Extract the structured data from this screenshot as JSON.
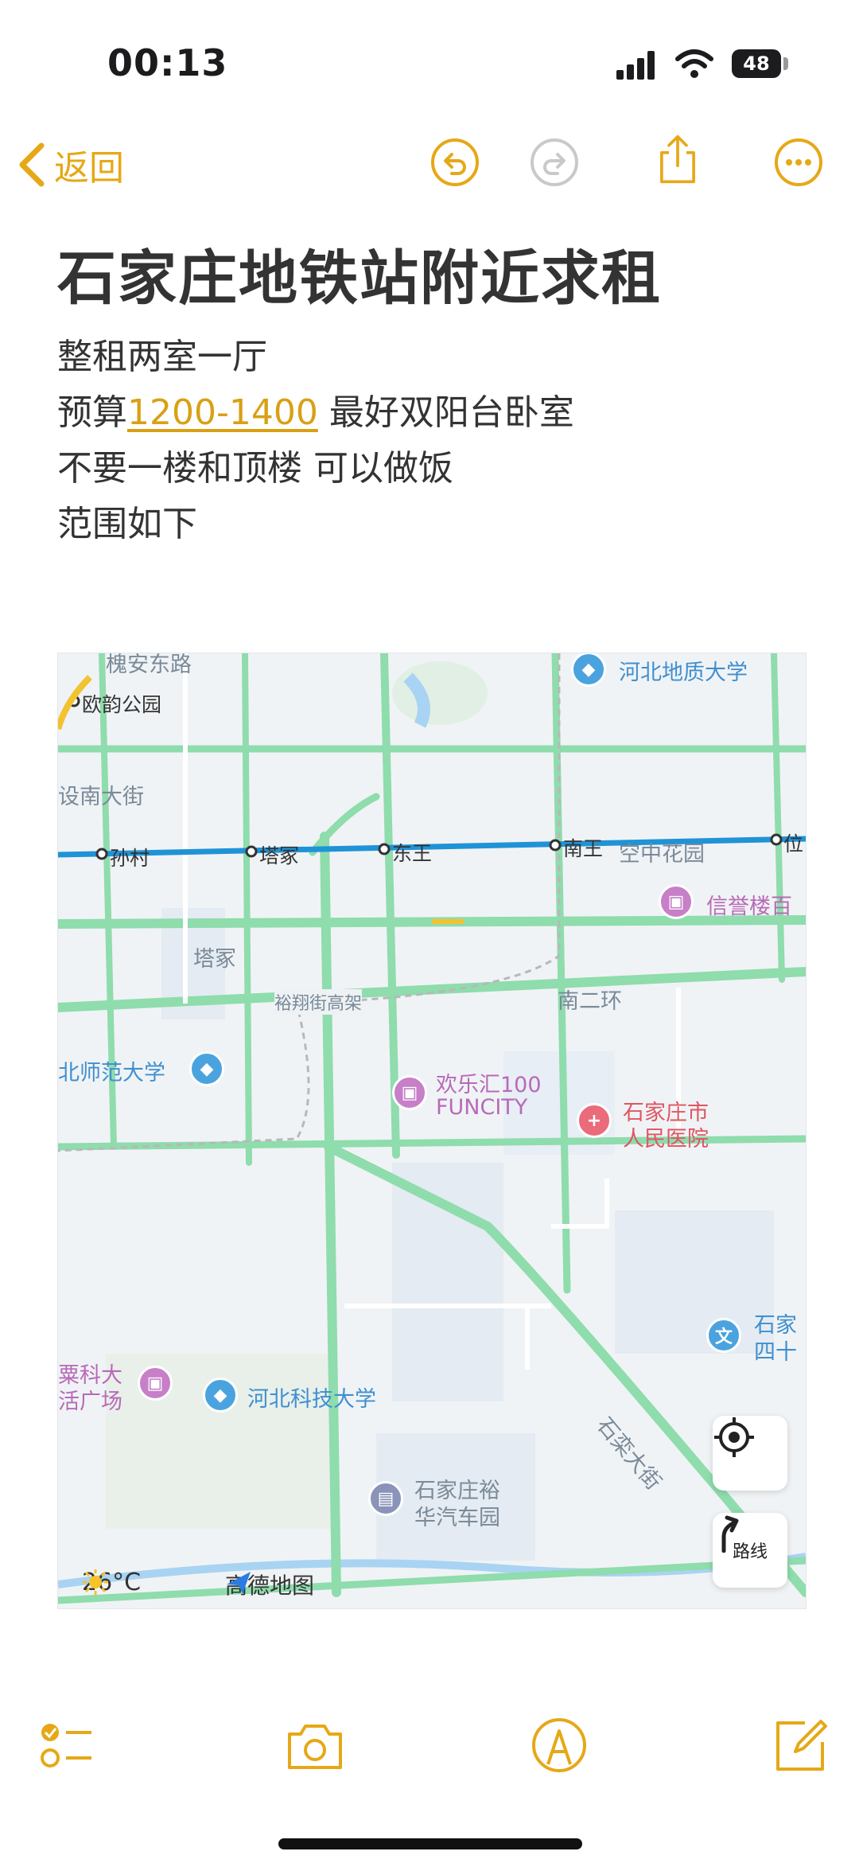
{
  "status_bar": {
    "time": "00:13",
    "battery": "48"
  },
  "nav": {
    "back_label": "返回"
  },
  "note": {
    "title": "石家庄地铁站附近求租",
    "line1": "整租两室一厅",
    "line2_prefix": "预算",
    "line2_link": "1200-1400",
    "line2_suffix": "最好双阳台卧室",
    "line3": "不要一楼和顶楼 可以做饭",
    "line4": "范围如下"
  },
  "map": {
    "labels": {
      "huaian_road": "槐安东路",
      "ouyun_park": "欧韵公园",
      "hebei_geo_univ": "河北地质大学",
      "jianshe_south": "设南大街",
      "suncun": "孙村",
      "tazhong_station": "塔冢",
      "dongwang": "东王",
      "nanwang": "南王",
      "wei": "位",
      "sky_garden": "空中花园",
      "xinyu_mall": "信誉楼百",
      "tazhong_area": "塔冢",
      "yuxiang_elevated": "裕翔街高架",
      "south_2nd_ring": "南二环",
      "hebei_normal": "北师范大学",
      "huanlehui": "欢乐汇100",
      "funcity": "FUNCITY",
      "sjz_hospital_1": "石家庄市",
      "sjz_hospital_2": "人民医院",
      "sjz_school_1": "石家",
      "sjz_school_2": "四十",
      "suke_1": "粟科大",
      "suke_2": "活广场",
      "hebei_keji": "河北科技大学",
      "shiluan_street": "石栾大街",
      "yuhua_bus_1": "石家庄裕",
      "yuhua_bus_2": "华汽车园",
      "route_button": "路线"
    },
    "weather": "26°C",
    "brand": "高德地图"
  },
  "colors": {
    "accent": "#e6a817",
    "road": "#8fdcad",
    "metro": "#1f93d6"
  }
}
